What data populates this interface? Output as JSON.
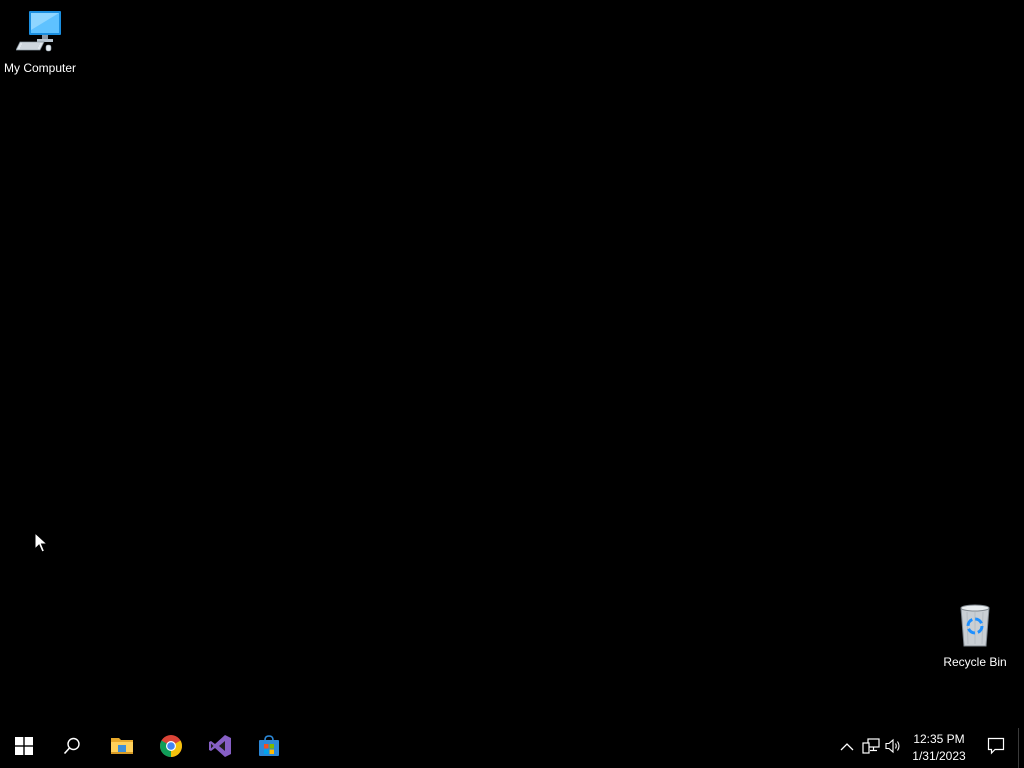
{
  "desktop": {
    "background_color": "#000000",
    "icons": [
      {
        "label": "My Computer",
        "icon": "computer-icon"
      },
      {
        "label": "Recycle Bin",
        "icon": "recycle-bin-icon"
      }
    ]
  },
  "taskbar": {
    "pinned": [
      {
        "name": "Start",
        "icon": "windows-logo-icon"
      },
      {
        "name": "Search",
        "icon": "search-icon"
      },
      {
        "name": "File Explorer",
        "icon": "folder-icon"
      },
      {
        "name": "Google Chrome",
        "icon": "chrome-icon"
      },
      {
        "name": "Visual Studio",
        "icon": "visual-studio-icon"
      },
      {
        "name": "Microsoft Store",
        "icon": "store-icon"
      }
    ],
    "tray": {
      "icons": [
        "chevron-up-icon",
        "network-icon",
        "volume-icon"
      ],
      "time": "12:35 PM",
      "date": "1/31/2023",
      "notifications_icon": "notification-icon"
    }
  }
}
